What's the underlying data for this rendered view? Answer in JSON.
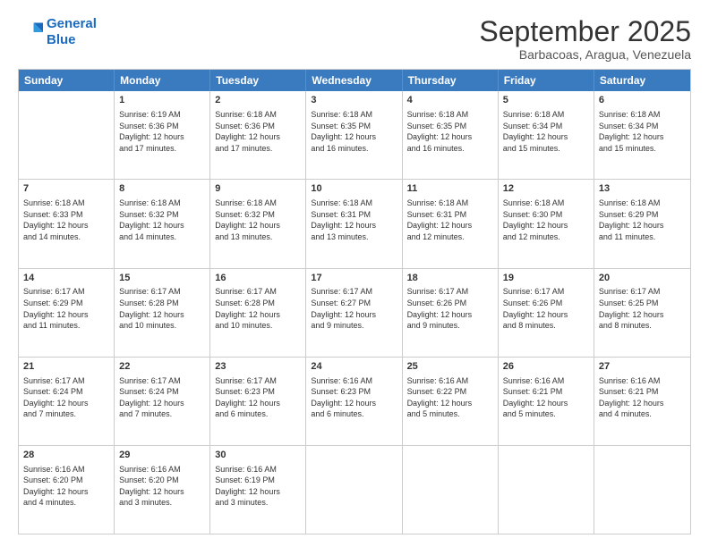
{
  "logo": {
    "line1": "General",
    "line2": "Blue"
  },
  "header": {
    "month": "September 2025",
    "location": "Barbacoas, Aragua, Venezuela"
  },
  "days": [
    "Sunday",
    "Monday",
    "Tuesday",
    "Wednesday",
    "Thursday",
    "Friday",
    "Saturday"
  ],
  "rows": [
    [
      {
        "day": "",
        "info": ""
      },
      {
        "day": "1",
        "info": "Sunrise: 6:19 AM\nSunset: 6:36 PM\nDaylight: 12 hours\nand 17 minutes."
      },
      {
        "day": "2",
        "info": "Sunrise: 6:18 AM\nSunset: 6:36 PM\nDaylight: 12 hours\nand 17 minutes."
      },
      {
        "day": "3",
        "info": "Sunrise: 6:18 AM\nSunset: 6:35 PM\nDaylight: 12 hours\nand 16 minutes."
      },
      {
        "day": "4",
        "info": "Sunrise: 6:18 AM\nSunset: 6:35 PM\nDaylight: 12 hours\nand 16 minutes."
      },
      {
        "day": "5",
        "info": "Sunrise: 6:18 AM\nSunset: 6:34 PM\nDaylight: 12 hours\nand 15 minutes."
      },
      {
        "day": "6",
        "info": "Sunrise: 6:18 AM\nSunset: 6:34 PM\nDaylight: 12 hours\nand 15 minutes."
      }
    ],
    [
      {
        "day": "7",
        "info": "Sunrise: 6:18 AM\nSunset: 6:33 PM\nDaylight: 12 hours\nand 14 minutes."
      },
      {
        "day": "8",
        "info": "Sunrise: 6:18 AM\nSunset: 6:32 PM\nDaylight: 12 hours\nand 14 minutes."
      },
      {
        "day": "9",
        "info": "Sunrise: 6:18 AM\nSunset: 6:32 PM\nDaylight: 12 hours\nand 13 minutes."
      },
      {
        "day": "10",
        "info": "Sunrise: 6:18 AM\nSunset: 6:31 PM\nDaylight: 12 hours\nand 13 minutes."
      },
      {
        "day": "11",
        "info": "Sunrise: 6:18 AM\nSunset: 6:31 PM\nDaylight: 12 hours\nand 12 minutes."
      },
      {
        "day": "12",
        "info": "Sunrise: 6:18 AM\nSunset: 6:30 PM\nDaylight: 12 hours\nand 12 minutes."
      },
      {
        "day": "13",
        "info": "Sunrise: 6:18 AM\nSunset: 6:29 PM\nDaylight: 12 hours\nand 11 minutes."
      }
    ],
    [
      {
        "day": "14",
        "info": "Sunrise: 6:17 AM\nSunset: 6:29 PM\nDaylight: 12 hours\nand 11 minutes."
      },
      {
        "day": "15",
        "info": "Sunrise: 6:17 AM\nSunset: 6:28 PM\nDaylight: 12 hours\nand 10 minutes."
      },
      {
        "day": "16",
        "info": "Sunrise: 6:17 AM\nSunset: 6:28 PM\nDaylight: 12 hours\nand 10 minutes."
      },
      {
        "day": "17",
        "info": "Sunrise: 6:17 AM\nSunset: 6:27 PM\nDaylight: 12 hours\nand 9 minutes."
      },
      {
        "day": "18",
        "info": "Sunrise: 6:17 AM\nSunset: 6:26 PM\nDaylight: 12 hours\nand 9 minutes."
      },
      {
        "day": "19",
        "info": "Sunrise: 6:17 AM\nSunset: 6:26 PM\nDaylight: 12 hours\nand 8 minutes."
      },
      {
        "day": "20",
        "info": "Sunrise: 6:17 AM\nSunset: 6:25 PM\nDaylight: 12 hours\nand 8 minutes."
      }
    ],
    [
      {
        "day": "21",
        "info": "Sunrise: 6:17 AM\nSunset: 6:24 PM\nDaylight: 12 hours\nand 7 minutes."
      },
      {
        "day": "22",
        "info": "Sunrise: 6:17 AM\nSunset: 6:24 PM\nDaylight: 12 hours\nand 7 minutes."
      },
      {
        "day": "23",
        "info": "Sunrise: 6:17 AM\nSunset: 6:23 PM\nDaylight: 12 hours\nand 6 minutes."
      },
      {
        "day": "24",
        "info": "Sunrise: 6:16 AM\nSunset: 6:23 PM\nDaylight: 12 hours\nand 6 minutes."
      },
      {
        "day": "25",
        "info": "Sunrise: 6:16 AM\nSunset: 6:22 PM\nDaylight: 12 hours\nand 5 minutes."
      },
      {
        "day": "26",
        "info": "Sunrise: 6:16 AM\nSunset: 6:21 PM\nDaylight: 12 hours\nand 5 minutes."
      },
      {
        "day": "27",
        "info": "Sunrise: 6:16 AM\nSunset: 6:21 PM\nDaylight: 12 hours\nand 4 minutes."
      }
    ],
    [
      {
        "day": "28",
        "info": "Sunrise: 6:16 AM\nSunset: 6:20 PM\nDaylight: 12 hours\nand 4 minutes."
      },
      {
        "day": "29",
        "info": "Sunrise: 6:16 AM\nSunset: 6:20 PM\nDaylight: 12 hours\nand 3 minutes."
      },
      {
        "day": "30",
        "info": "Sunrise: 6:16 AM\nSunset: 6:19 PM\nDaylight: 12 hours\nand 3 minutes."
      },
      {
        "day": "",
        "info": ""
      },
      {
        "day": "",
        "info": ""
      },
      {
        "day": "",
        "info": ""
      },
      {
        "day": "",
        "info": ""
      }
    ]
  ]
}
